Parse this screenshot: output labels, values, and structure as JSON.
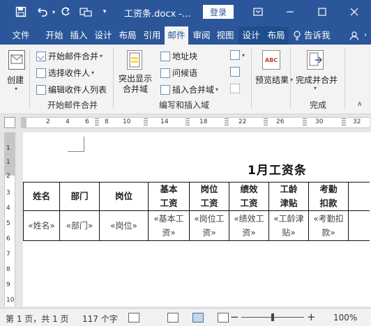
{
  "titlebar": {
    "doc_title": "工资条.docx  -...",
    "login_label": "登录",
    "icons": [
      "save-icon",
      "undo-icon",
      "redo-icon",
      "touch-mode-icon",
      "customize-qat-icon"
    ]
  },
  "ribbon_tabs": [
    "文件",
    "开始",
    "插入",
    "设计",
    "布局",
    "引用",
    "邮件",
    "审阅",
    "视图",
    "设计",
    "布局"
  ],
  "tell_me": "告诉我",
  "ribbon": {
    "create_group": {
      "create_label": "创建"
    },
    "start_merge": {
      "start_label": "开始邮件合并",
      "select_label": "选择收件人",
      "edit_label": "编辑收件人列表",
      "group_label": "开始邮件合并"
    },
    "write_insert": {
      "highlight_line1": "突出显示",
      "highlight_line2": "合并域",
      "address_label": "地址块",
      "greeting_label": "问候语",
      "insert_field_label": "插入合并域",
      "group_label": "编写和插入域"
    },
    "preview": {
      "preview_label": "预览结果",
      "abc_label": "ABC"
    },
    "finish": {
      "finish_label": "完成并合并",
      "group_label": "完成"
    }
  },
  "ruler": {
    "numbers": [
      "2",
      "4",
      "6",
      "8",
      "10",
      "14",
      "18",
      "22",
      "26",
      "30",
      "32"
    ]
  },
  "vruler": {
    "numbers": [
      "1",
      "1",
      "2",
      "3",
      "4",
      "5",
      "6",
      "7",
      "8",
      "9",
      "10"
    ]
  },
  "document": {
    "heading": "1月工资条",
    "table": {
      "headers": [
        "姓名",
        "部门",
        "岗位",
        "基本工资",
        "岗位工资",
        "绩效工资",
        "工龄津贴",
        "考勤扣款"
      ],
      "row": [
        "«姓名»",
        "«部门»",
        "«岗位»",
        "«基本工资»",
        "«岗位工资»",
        "«绩效工资»",
        "«工龄津贴»",
        "«考勤扣款»"
      ]
    }
  },
  "statusbar": {
    "page_info": "第 1 页，共 1 页",
    "word_count": "117 个字",
    "zoom": "100%",
    "zoom_minus": "−",
    "zoom_plus": "+"
  }
}
